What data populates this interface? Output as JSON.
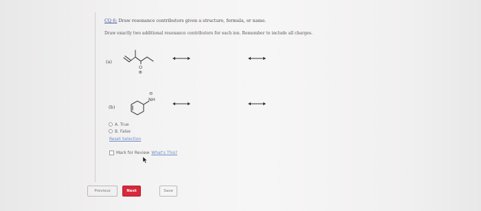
{
  "question": {
    "id": "CQ 6:",
    "title": "Draw resonance contributors given a structure, formula, or name.",
    "instruction": "Draw exactly two additional resonance contributors for each ion. Remember to include all charges."
  },
  "parts": [
    {
      "label": "(a)",
      "charge_symbol": "⊕",
      "atom_label": "O"
    },
    {
      "label": "(b)",
      "charge_symbol": "⊖",
      "atom_label": "NH"
    }
  ],
  "options": [
    {
      "label": "A. True",
      "selected": false
    },
    {
      "label": "B. False",
      "selected": false
    }
  ],
  "reset_label": "Reset Selection",
  "mark_review": {
    "label": "Mark for Review",
    "link": "What's This?",
    "checked": false
  },
  "buttons": {
    "previous": "Previous",
    "next": "Next",
    "save": "Save"
  },
  "colors": {
    "next_button": "#d8283c",
    "link": "#6a8cc6"
  },
  "icons": {
    "cursor": "mouse-pointer-icon"
  }
}
